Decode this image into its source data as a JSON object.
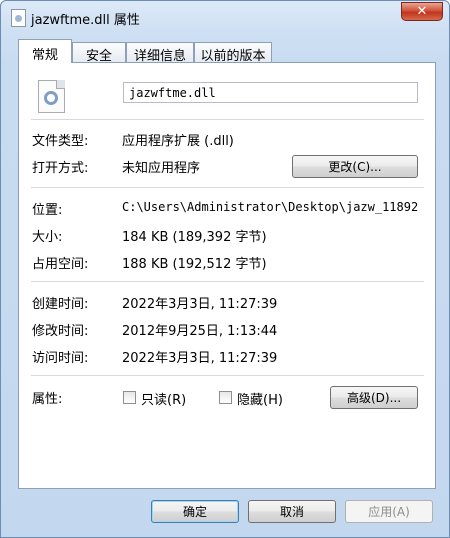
{
  "window": {
    "title": "jazwftme.dll 属性",
    "close_label": "✕"
  },
  "tabs": [
    {
      "label": "常规",
      "active": true
    },
    {
      "label": "安全",
      "active": false
    },
    {
      "label": "详细信息",
      "active": false
    },
    {
      "label": "以前的版本",
      "active": false
    }
  ],
  "general": {
    "file_name": "jazwftme.dll",
    "rows": {
      "type_label": "文件类型:",
      "type_value": "应用程序扩展 (.dll)",
      "opens_label": "打开方式:",
      "opens_value": "未知应用程序",
      "change_button": "更改(C)...",
      "location_label": "位置:",
      "location_value": "C:\\Users\\Administrator\\Desktop\\jazw_11892",
      "size_label": "大小:",
      "size_value": "184 KB (189,392 字节)",
      "disk_label": "占用空间:",
      "disk_value": "188 KB (192,512 字节)",
      "created_label": "创建时间:",
      "created_value": "2022年3月3日, 11:27:39",
      "modified_label": "修改时间:",
      "modified_value": "2012年9月25日, 1:13:44",
      "accessed_label": "访问时间:",
      "accessed_value": "2022年3月3日, 11:27:39",
      "attributes_label": "属性:",
      "readonly_label": "只读(R)",
      "hidden_label": "隐藏(H)",
      "advanced_button": "高级(D)..."
    }
  },
  "footer": {
    "ok_button": "确定",
    "cancel_button": "取消",
    "apply_button": "应用(A)"
  }
}
